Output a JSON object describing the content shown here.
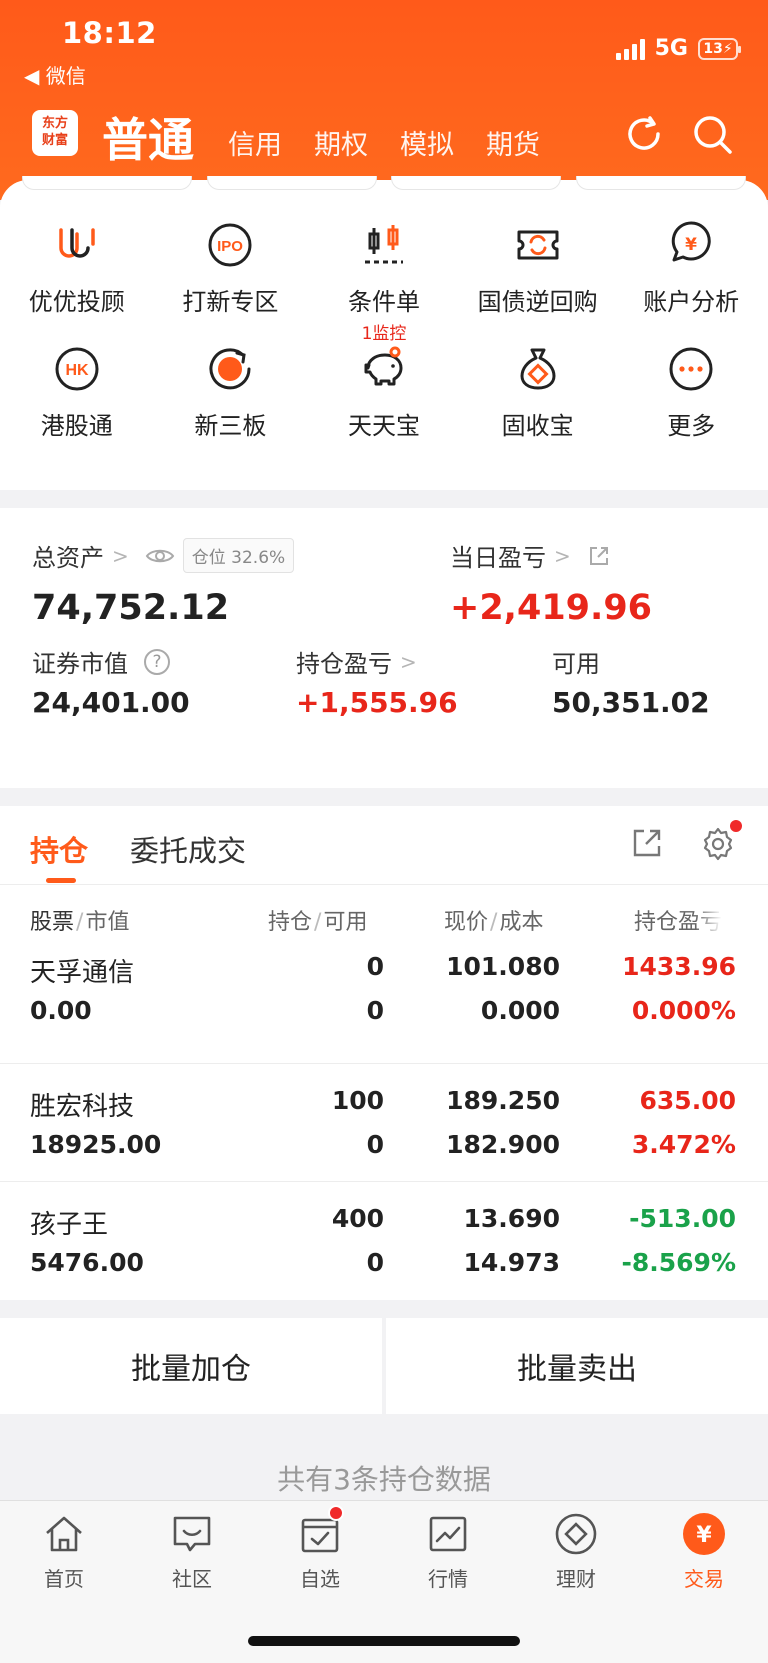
{
  "status_bar": {
    "time": "18:12",
    "back_label": "◀ 微信",
    "network": "5G",
    "battery": "13"
  },
  "header": {
    "logo_line1": "东方",
    "logo_line2": "财富",
    "tabs": [
      "普通",
      "信用",
      "期权",
      "模拟",
      "期货"
    ]
  },
  "quick_menu": [
    {
      "label": "优优投顾",
      "icon": "uu-advisor-icon"
    },
    {
      "label": "打新专区",
      "icon": "ipo-icon"
    },
    {
      "label": "条件单",
      "icon": "condition-order-icon",
      "sub": "1监控"
    },
    {
      "label": "国债逆回购",
      "icon": "bond-repo-icon"
    },
    {
      "label": "账户分析",
      "icon": "account-analysis-icon"
    },
    {
      "label": "港股通",
      "icon": "hk-icon"
    },
    {
      "label": "新三板",
      "icon": "neeq-icon"
    },
    {
      "label": "天天宝",
      "icon": "piggy-bank-icon"
    },
    {
      "label": "固收宝",
      "icon": "money-bag-icon"
    },
    {
      "label": "更多",
      "icon": "more-icon"
    }
  ],
  "assets": {
    "total_label": "总资产",
    "position_ratio": "仓位 32.6%",
    "total_value": "74,752.12",
    "daily_pl_label": "当日盈亏",
    "daily_pl_value": "+2,419.96",
    "market_value_label": "证券市值",
    "market_value": "24,401.00",
    "holding_pl_label": "持仓盈亏",
    "holding_pl_value": "+1,555.96",
    "available_label": "可用",
    "available_value": "50,351.02"
  },
  "holdings": {
    "tabs": [
      "持仓",
      "委托成交"
    ],
    "columns": [
      {
        "a": "股票",
        "b": "市值"
      },
      {
        "a": "持仓",
        "b": "可用"
      },
      {
        "a": "现价",
        "b": "成本"
      },
      {
        "a": "持仓盈亏",
        "b": ""
      }
    ],
    "rows": [
      {
        "name": "天孚通信",
        "mv": "0.00",
        "qty": "0",
        "avail": "0",
        "price": "101.080",
        "cost": "0.000",
        "pl": "1433.96",
        "pl_pct": "0.000%",
        "tone": "red"
      },
      {
        "name": "胜宏科技",
        "mv": "18925.00",
        "qty": "100",
        "avail": "0",
        "price": "189.250",
        "cost": "182.900",
        "pl": "635.00",
        "pl_pct": "3.472%",
        "tone": "red"
      },
      {
        "name": "孩子王",
        "mv": "5476.00",
        "qty": "400",
        "avail": "0",
        "price": "13.690",
        "cost": "14.973",
        "pl": "-513.00",
        "pl_pct": "-8.569%",
        "tone": "green"
      }
    ]
  },
  "actions": {
    "bulk_add": "批量加仓",
    "bulk_sell": "批量卖出"
  },
  "footer_text": "共有3条持仓数据",
  "tabbar": [
    {
      "label": "首页",
      "icon": "home-icon"
    },
    {
      "label": "社区",
      "icon": "community-icon"
    },
    {
      "label": "自选",
      "icon": "watchlist-icon"
    },
    {
      "label": "行情",
      "icon": "market-icon"
    },
    {
      "label": "理财",
      "icon": "wealth-icon"
    },
    {
      "label": "交易",
      "icon": "trade-icon",
      "active": true
    }
  ],
  "colors": {
    "brand": "#ff5a1a",
    "up": "#e8261a",
    "down": "#1aa24a"
  }
}
